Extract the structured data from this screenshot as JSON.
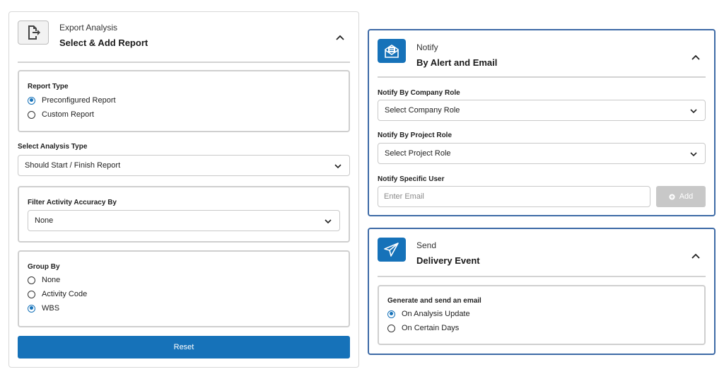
{
  "export_card": {
    "subtitle": "Export Analysis",
    "title": "Select & Add Report",
    "report_type": {
      "label": "Report Type",
      "options": [
        "Preconfigured Report",
        "Custom Report"
      ],
      "selected": "Preconfigured Report"
    },
    "analysis_type": {
      "label": "Select Analysis Type",
      "value": "Should Start / Finish Report"
    },
    "filter_accuracy": {
      "label": "Filter Activity Accuracy By",
      "value": "None"
    },
    "group_by": {
      "label": "Group By",
      "options": [
        "None",
        "Activity Code",
        "WBS"
      ],
      "selected": "WBS"
    },
    "reset_label": "Reset"
  },
  "notify_card": {
    "subtitle": "Notify",
    "title": "By Alert and Email",
    "company_role": {
      "label": "Notify By Company Role",
      "value": "Select Company Role"
    },
    "project_role": {
      "label": "Notify By Project Role",
      "value": "Select Project Role"
    },
    "specific_user": {
      "label": "Notify Specific User",
      "placeholder": "Enter Email",
      "add_label": "Add"
    }
  },
  "send_card": {
    "subtitle": "Send",
    "title": "Delivery Event",
    "generate": {
      "label": "Generate and send an email",
      "options": [
        "On Analysis Update",
        "On Certain Days"
      ],
      "selected": "On Analysis Update"
    }
  },
  "colors": {
    "accent": "#1672b9",
    "active_border": "#3d6aa6",
    "disabled_button": "#c8c8c8"
  },
  "icons": {
    "export": "export-file-icon",
    "notify": "envelope-alert-icon",
    "send": "paper-plane-icon",
    "collapse": "chevron-up-icon",
    "dropdown": "chevron-down-icon",
    "add": "plus-circle-icon"
  }
}
